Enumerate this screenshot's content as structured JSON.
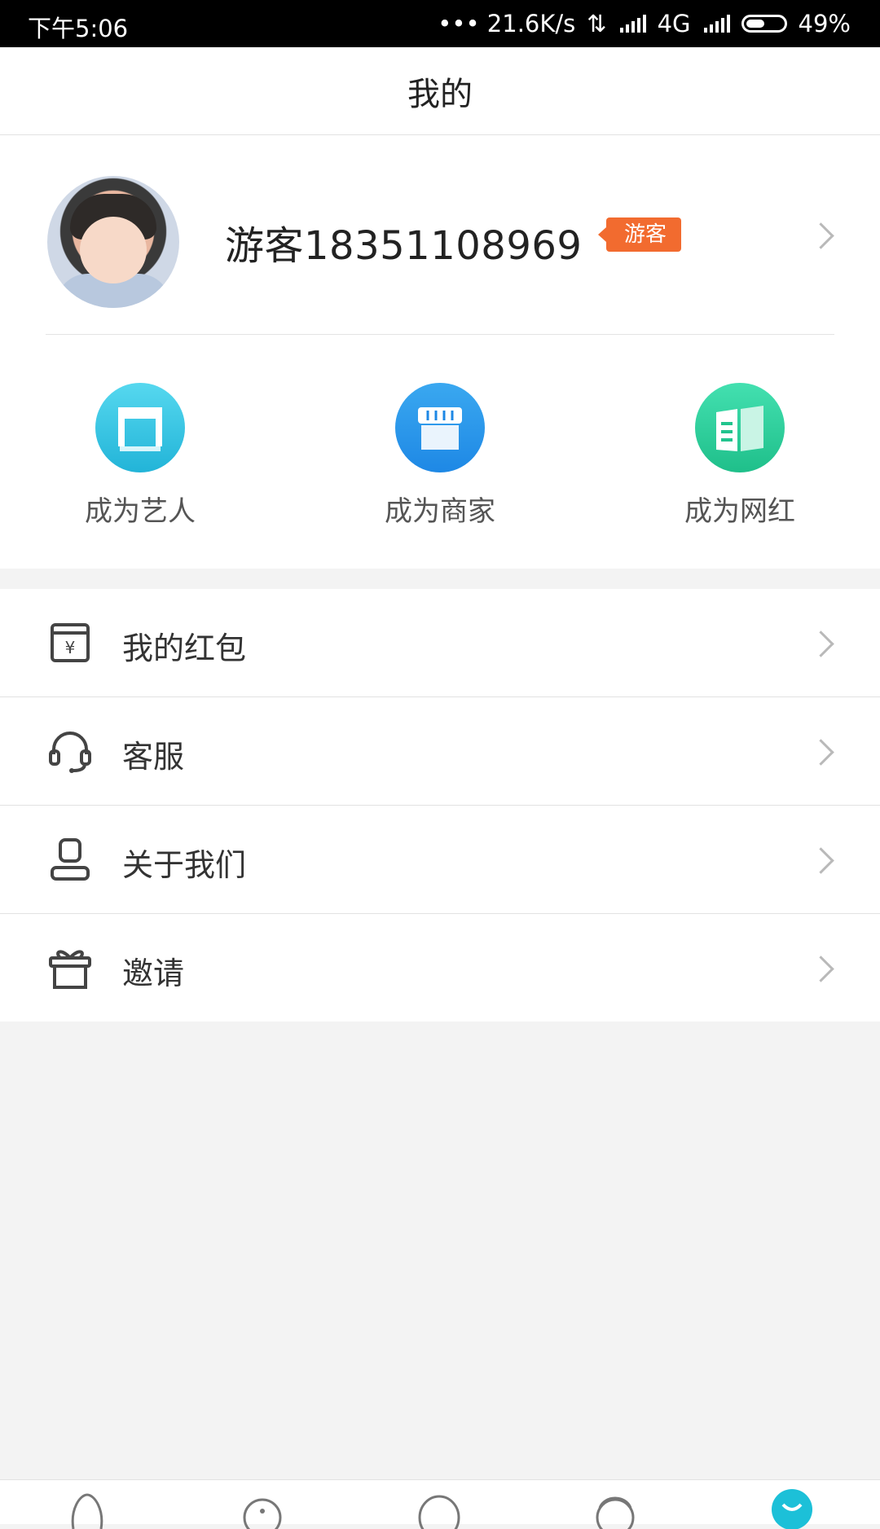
{
  "status_bar": {
    "time": "下午5:06",
    "net_speed": "••• 21.6K/s",
    "network": "4G",
    "battery": "49%"
  },
  "header": {
    "title": "我的"
  },
  "profile": {
    "name": "游客18351108969",
    "badge": "游客",
    "avatar_icon": "user-avatar-photo"
  },
  "roles": [
    {
      "label": "成为艺人",
      "icon": "stage-icon",
      "color": "#2bbbe0"
    },
    {
      "label": "成为商家",
      "icon": "shop-icon",
      "color": "#1e88e5"
    },
    {
      "label": "成为网红",
      "icon": "book-icon",
      "color": "#22c48e"
    }
  ],
  "menu": [
    {
      "label": "我的红包",
      "icon": "red-envelope-icon"
    },
    {
      "label": "客服",
      "icon": "headset-icon"
    },
    {
      "label": "关于我们",
      "icon": "person-icon"
    },
    {
      "label": "邀请",
      "icon": "gift-icon"
    }
  ],
  "tabbar": {
    "active_index": 4,
    "active_color": "#1cc0d8",
    "icons": [
      "home-tab-icon",
      "discover-tab-icon",
      "message-tab-icon",
      "friends-tab-icon",
      "profile-tab-icon"
    ]
  }
}
